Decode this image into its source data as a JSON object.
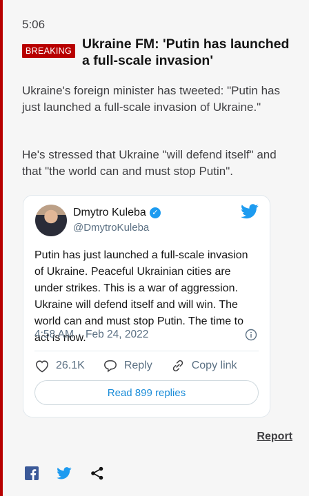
{
  "post": {
    "time": "5:06",
    "badge": "BREAKING",
    "headline": "Ukraine FM: 'Putin has launched a full-scale invasion'",
    "paragraphs": [
      "Ukraine's foreign minister has tweeted: \"Putin has just launched a full-scale invasion of Ukraine.\"",
      "He's stressed that Ukraine \"will defend itself\" and that \"the world can and must stop Putin\"."
    ]
  },
  "tweet": {
    "author_name": "Dmytro Kuleba",
    "handle": "@DmytroKuleba",
    "text": "Putin has just launched a full-scale invasion of Ukraine. Peaceful Ukrainian cities are under strikes. This is a war of aggression. Ukraine will defend itself and will win. The world can and must stop Putin. The time to act is now.",
    "time": "4:58 AM",
    "separator": "·",
    "date": "Feb 24, 2022",
    "likes": "26.1K",
    "reply_label": "Reply",
    "copy_link_label": "Copy link",
    "read_replies": "Read 899 replies",
    "icons": [
      "verified-icon",
      "twitter-bird-icon",
      "info-icon",
      "heart-icon",
      "reply-bubble-icon",
      "link-icon"
    ]
  },
  "footer": {
    "report": "Report",
    "share_icons": [
      "facebook-icon",
      "twitter-icon",
      "share-icon"
    ]
  },
  "colors": {
    "accent_red": "#b80000",
    "twitter_blue": "#1d9bf0",
    "link_blue": "#1a8cd8"
  }
}
